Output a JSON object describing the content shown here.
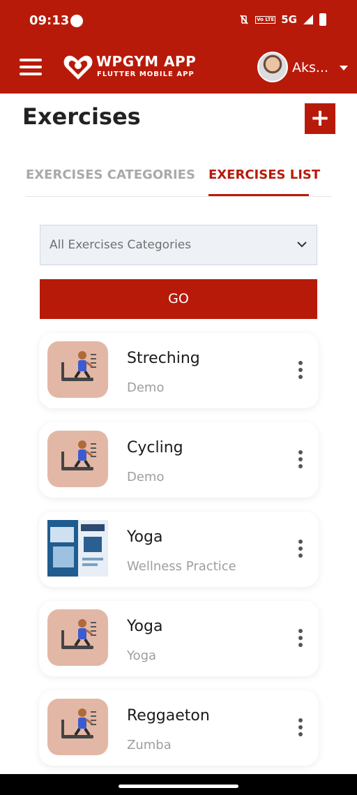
{
  "status_bar": {
    "time": "09:13",
    "network": "5G",
    "volte": "Vo LTE"
  },
  "app_bar": {
    "brand_title": "WPGYM APP",
    "brand_subtitle": "FLUTTER MOBILE APP",
    "user_name": "Aks..."
  },
  "page": {
    "title": "Exercises",
    "add_label": "+"
  },
  "tabs": [
    {
      "label": "EXERCISES CATEGORIES",
      "active": false
    },
    {
      "label": "EXERCISES LIST",
      "active": true
    }
  ],
  "filter": {
    "selected": "All Exercises Categories",
    "go_label": "GO"
  },
  "exercises": [
    {
      "title": "Streching",
      "category": "Demo",
      "thumbnail": "treadmill-runner-icon"
    },
    {
      "title": "Cycling",
      "category": "Demo",
      "thumbnail": "treadmill-runner-icon"
    },
    {
      "title": "Yoga",
      "category": "Wellness Practice",
      "thumbnail": "plugin-screenshot-image"
    },
    {
      "title": "Yoga",
      "category": "Yoga",
      "thumbnail": "treadmill-runner-icon"
    },
    {
      "title": "Reggaeton",
      "category": "Zumba",
      "thumbnail": "treadmill-runner-icon"
    }
  ],
  "colors": {
    "brand": "#b81a0a",
    "thumb_bg": "#e3b7a6",
    "muted_text": "#9e9e9e"
  }
}
